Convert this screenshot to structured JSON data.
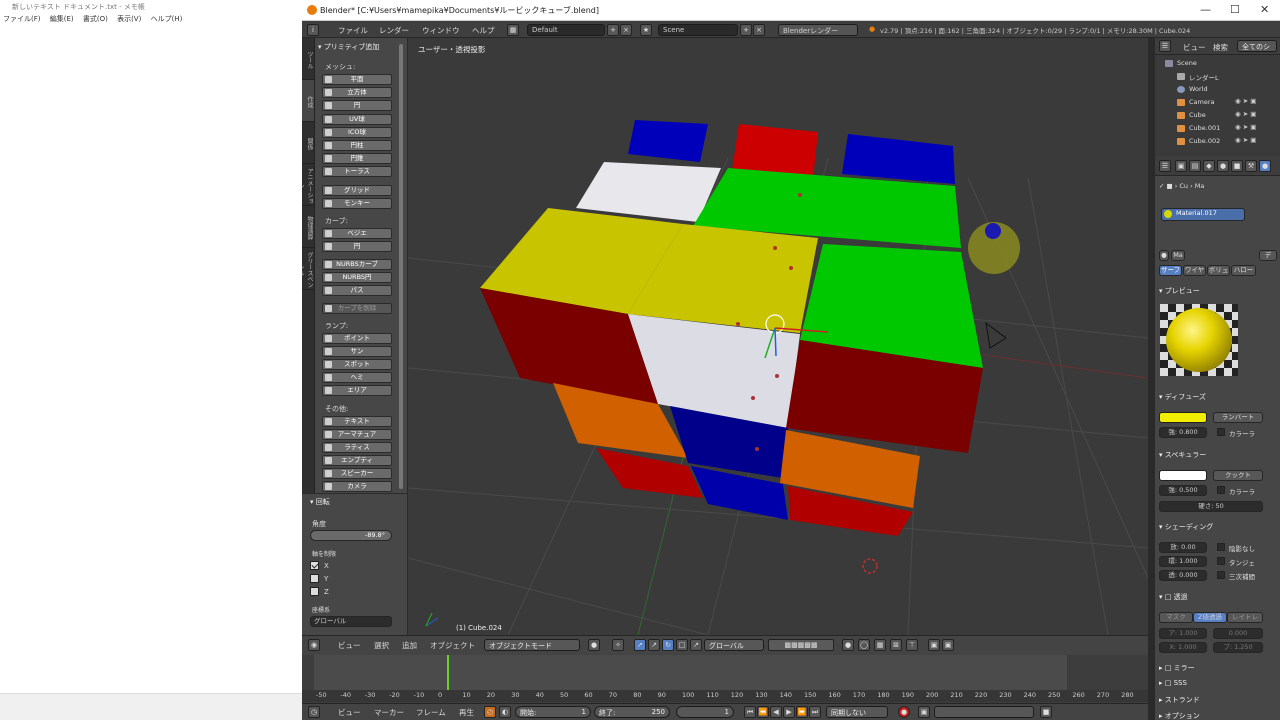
{
  "notepad": {
    "title": "新しいテキスト ドキュメント.txt - メモ帳",
    "menu": [
      "ファイル(F)",
      "編集(E)",
      "書式(O)",
      "表示(V)",
      "ヘルプ(H)"
    ]
  },
  "blender": {
    "title": "Blender* [C:¥Users¥mamepika¥Documents¥ルービックキューブ.blend]",
    "info_menu": [
      "ファイル",
      "レンダー",
      "ウィンドウ",
      "ヘルプ"
    ],
    "layout": "Default",
    "scene": "Scene",
    "engine": "Blenderレンダー",
    "stats": "v2.79 | 頂点:216 | 面:162 | 三角面:324 | オブジェクト:0/29 | ランプ:0/1 | メモリ:28.30M | Cube.024",
    "tabs": [
      "ツール",
      "作成",
      "関係",
      "アニメーション",
      "物理演算",
      "グリースペンシル"
    ],
    "toolshelf": {
      "header": "プリミティブ追加",
      "mesh_label": "メッシュ:",
      "mesh": [
        "平面",
        "立方体",
        "円",
        "UV球",
        "ICO球",
        "円柱",
        "円錐",
        "トーラス"
      ],
      "mesh2": [
        "グリッド",
        "モンキー"
      ],
      "curve_label": "カーブ:",
      "curve": [
        "ベジエ",
        "円"
      ],
      "nurbs": [
        "NURBSカーブ",
        "NURBS円",
        "パス"
      ],
      "curve_edit": "カーブを削除",
      "lamp_label": "ランプ:",
      "lamp": [
        "ポイント",
        "サン",
        "スポット",
        "ヘミ",
        "エリア"
      ],
      "other_label": "その他:",
      "other": [
        "テキスト",
        "アーマチュア",
        "ラティス",
        "エンプティ",
        "スピーカー",
        "カメラ"
      ]
    },
    "operator": {
      "header": "回転",
      "angle_label": "角度",
      "angle_value": "-89.8°",
      "axis_label": "軸を制限",
      "axes": [
        "X",
        "Y",
        "Z"
      ],
      "axes_checked": [
        true,
        false,
        false
      ],
      "orient_label": "座標系",
      "orient_value": "グローバル"
    },
    "viewport": {
      "label": "ユーザー・透視投影",
      "object_label": "(1) Cube.024",
      "sticker_colors": {
        "red": "#cc0000",
        "green": "#00c800",
        "blue": "#0000bb",
        "yellow": "#cccc00",
        "white": "#e8e8ec",
        "orange": "#e06a00",
        "darkred": "#7a0000"
      }
    },
    "view_header": {
      "menu": [
        "ビュー",
        "選択",
        "追加",
        "オブジェクト"
      ],
      "mode": "オブジェクトモード",
      "orientation": "グローバル"
    },
    "timeline": {
      "ticks": [
        "-50",
        "-40",
        "-30",
        "-20",
        "-10",
        "0",
        "10",
        "20",
        "30",
        "40",
        "50",
        "60",
        "70",
        "80",
        "90",
        "100",
        "110",
        "120",
        "130",
        "140",
        "150",
        "160",
        "170",
        "180",
        "190",
        "200",
        "210",
        "220",
        "230",
        "240",
        "250",
        "260",
        "270",
        "280"
      ],
      "menu": [
        "ビュー",
        "マーカー",
        "フレーム",
        "再生"
      ],
      "start_label": "開始:",
      "start": "1",
      "end_label": "終了:",
      "end": "250",
      "current": "1",
      "sync": "同期しない"
    },
    "outliner": {
      "header": [
        "ビュー",
        "検索",
        "全てのシ"
      ],
      "rows": [
        "Scene",
        "レンダーL",
        "World",
        "Camera",
        "Cube",
        "Cube.001",
        "Cube.002"
      ]
    },
    "properties": {
      "material_short": "Cu",
      "material_slot": "Material.017",
      "material_name": "Ma",
      "new_label": "デ",
      "preview_tabs": [
        "サーフ",
        "ワイヤ",
        "ボリュ",
        "ハロー"
      ],
      "preview_header": "プレビュー",
      "diffuse_header": "ディフューズ",
      "diffuse_color": "#f2ee00",
      "diffuse_shader": "ランバート",
      "diffuse_intensity": "強: 0.800",
      "ramp": "カラーラ",
      "specular_header": "スペキュラー",
      "specular_color": "#ffffff",
      "specular_shader": "クックト",
      "specular_intensity": "強: 0.500",
      "specular_ramp": "カラーラ",
      "hardness": "硬さ: 50",
      "shading_header": "シェーディング",
      "emit": "放: 0.00",
      "ambient": "環: 1.000",
      "translucency": "透: 0.000",
      "shadeless": "陰影なし",
      "tangent": "タンジェ",
      "cubic": "三次補間",
      "transparency_header": "透過",
      "trans_tabs": [
        "マスク",
        "Z値透過",
        "レイトレ"
      ],
      "alpha": "ア: 1.000",
      "fresnel": "0.000",
      "spec_trans": "X: 1.000",
      "blend": "ブ: 1.250",
      "mirror_header": "ミラー",
      "sss_header": "SSS",
      "strand_header": "ストランド",
      "options_header": "オプション"
    }
  }
}
